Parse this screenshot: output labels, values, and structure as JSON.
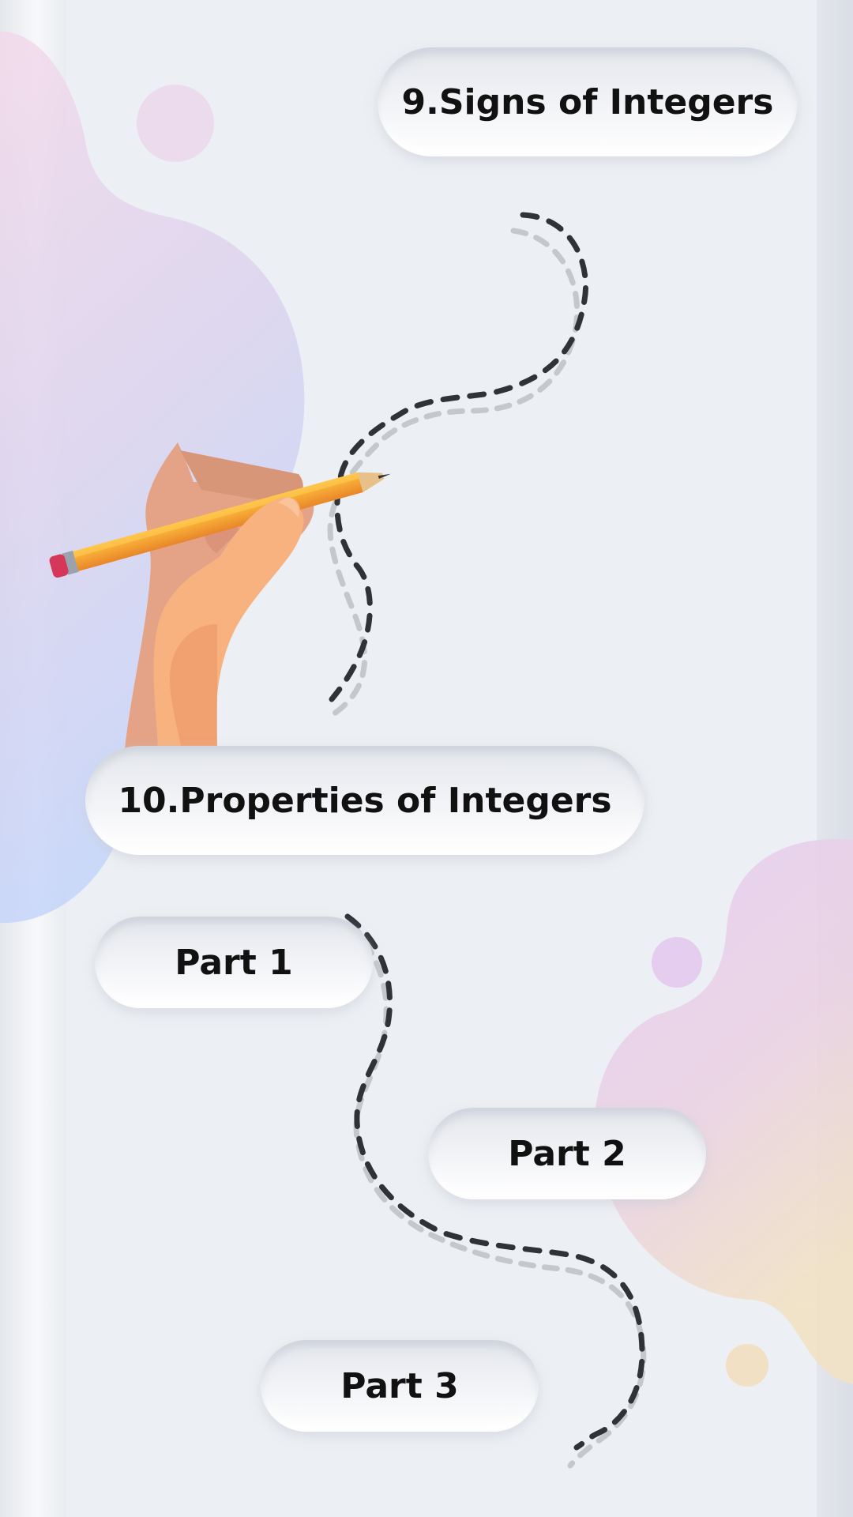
{
  "topics": [
    {
      "label": "9.Signs of Integers"
    },
    {
      "label": "10.Properties of Integers"
    }
  ],
  "parts": [
    {
      "label": "Part 1"
    },
    {
      "label": "Part 2"
    },
    {
      "label": "Part 3"
    }
  ],
  "illustration": {
    "icon": "hand-writing-with-pencil-icon"
  },
  "colors": {
    "background": "#eceff3",
    "text": "#111111",
    "dash_dark": "#2f3236",
    "dash_light": "#c4c6c9",
    "pencil": "#f5a12b",
    "eraser": "#d6365a",
    "skin": "#f7b27f"
  }
}
